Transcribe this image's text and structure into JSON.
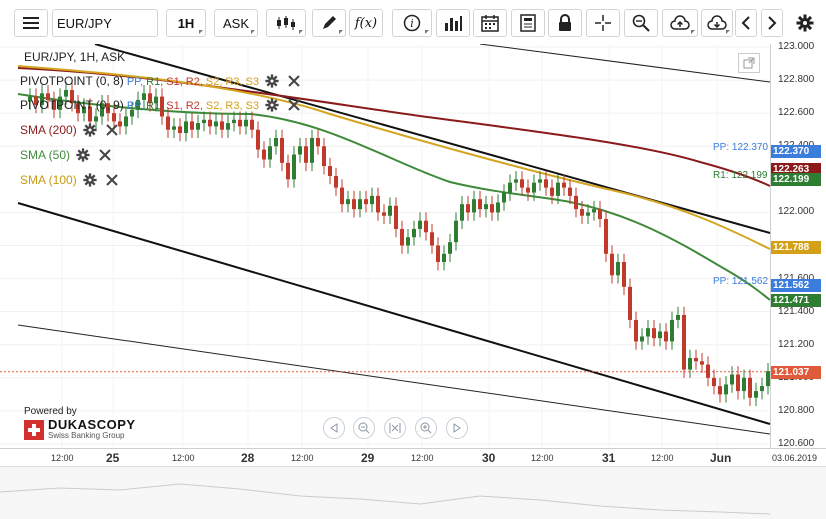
{
  "toolbar": {
    "instrument": "EUR/JPY",
    "period": "1H",
    "side": "ASK",
    "fx_label": "f(x)"
  },
  "legend": {
    "title": "EUR/JPY, 1H, ASK",
    "pivot1": {
      "name": "PIVOTPOINT (0, 8)",
      "levels": [
        "PP",
        "R1",
        "S1",
        "R2",
        "S2",
        "R3",
        "S3"
      ]
    },
    "pivot2": {
      "name": "PIVOTPOINT (0, 9)",
      "levels": [
        "PP",
        "R1",
        "S1",
        "R2",
        "S2",
        "R3",
        "S3"
      ]
    },
    "sma200": "SMA (200)",
    "sma50": "SMA (50)",
    "sma100": "SMA (100)"
  },
  "overlay_labels": {
    "pp_upper": "PP: 122.370",
    "r1": "R1: 122.199",
    "pp_lower": "PP: 121.562"
  },
  "price_axis": {
    "ticks": [
      "123.000",
      "122.800",
      "122.600",
      "122.400",
      "122.000",
      "121.800",
      "121.600",
      "121.400",
      "121.200",
      "121.000",
      "120.800",
      "120.600"
    ],
    "tags": [
      {
        "label": "122.370",
        "color": "#3b7ddd"
      },
      {
        "label": "122.263",
        "color": "#8b1a1a"
      },
      {
        "label": "122.199",
        "color": "#2e7d32"
      },
      {
        "label": "121.788",
        "color": "#d4a017"
      },
      {
        "label": "121.562",
        "color": "#3b7ddd"
      },
      {
        "label": "121.471",
        "color": "#2e7d32"
      },
      {
        "label": "121.037",
        "color": "#e05a3c"
      }
    ]
  },
  "time_axis": {
    "labels": [
      "12:00",
      "25",
      "12:00",
      "28",
      "12:00",
      "29",
      "12:00",
      "30",
      "12:00",
      "31",
      "12:00",
      "Jun"
    ],
    "date": "03.06.2019"
  },
  "branding": {
    "powered_by": "Powered by",
    "name": "DUKASCOPY",
    "tagline": "Swiss Banking Group"
  },
  "colors": {
    "sma200": "#8b1a1a",
    "sma50": "#3f8a3a",
    "sma100": "#d4a520",
    "bull": "#2e7d32",
    "bear": "#c0392b",
    "pivot_pp": "#3b7ddd"
  }
}
